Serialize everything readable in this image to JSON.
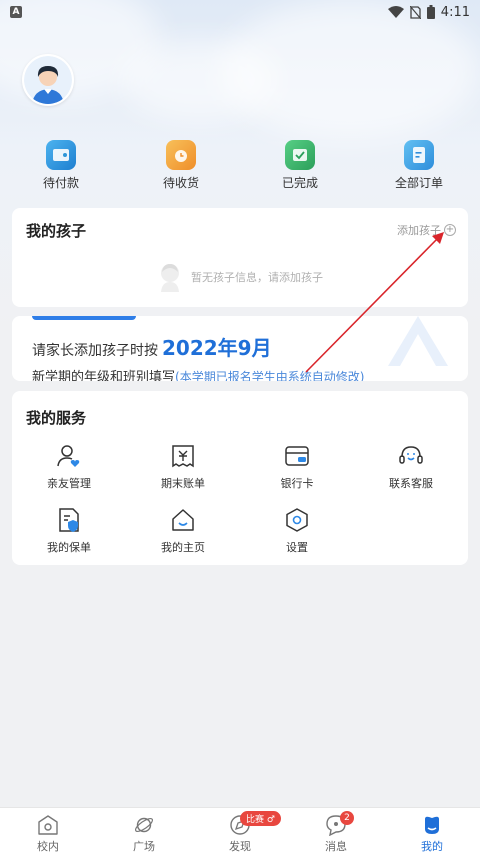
{
  "status_bar": {
    "time": "4:11",
    "app_badge": "A"
  },
  "orders": [
    {
      "label": "待付款",
      "icon": "wallet-icon",
      "color": "#2d96d8"
    },
    {
      "label": "待收货",
      "icon": "clock-box-icon",
      "color": "#f2a43a"
    },
    {
      "label": "已完成",
      "icon": "check-box-icon",
      "color": "#3cb56c"
    },
    {
      "label": "全部订单",
      "icon": "list-doc-icon",
      "color": "#3aa3e0"
    }
  ],
  "children": {
    "title": "我的孩子",
    "add_label": "添加孩子",
    "add_icon": "+",
    "empty_text": "暂无孩子信息，请添加孩子"
  },
  "banner": {
    "line1_prefix": "请家长添加孩子时按",
    "line1_date": "2022年9月",
    "line2_main": "新学期的年级和班别填写",
    "line2_note": "(本学期已报名学生由系统自动修改)"
  },
  "services": {
    "title": "我的服务",
    "items": [
      {
        "label": "亲友管理",
        "icon": "family-icon"
      },
      {
        "label": "期末账单",
        "icon": "bill-icon"
      },
      {
        "label": "银行卡",
        "icon": "bank-card-icon"
      },
      {
        "label": "联系客服",
        "icon": "headset-icon"
      },
      {
        "label": "我的保单",
        "icon": "insurance-icon"
      },
      {
        "label": "我的主页",
        "icon": "home-icon"
      },
      {
        "label": "设置",
        "icon": "settings-icon"
      }
    ]
  },
  "nav": {
    "items": [
      {
        "label": "校内",
        "icon": "school-icon"
      },
      {
        "label": "广场",
        "icon": "planet-icon"
      },
      {
        "label": "发现",
        "icon": "compass-icon"
      },
      {
        "label": "消息",
        "icon": "message-icon"
      },
      {
        "label": "我的",
        "icon": "profile-icon"
      }
    ],
    "discover_badge": "比赛 ♂",
    "message_badge": "2",
    "active_color": "#1f6fd8"
  }
}
